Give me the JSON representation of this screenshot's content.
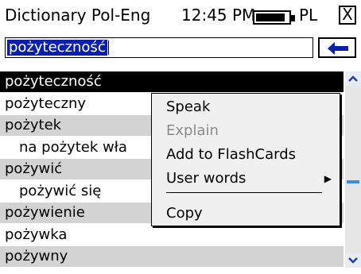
{
  "titlebar": {
    "title": "Dictionary Pol-Eng",
    "time": "12:45 PM",
    "battery_level": 0.9,
    "language": "PL",
    "close_glyph": "X"
  },
  "search": {
    "value": "pożyteczność",
    "back_icon": "back-arrow-icon"
  },
  "list": {
    "items": [
      {
        "label": "pożyteczność",
        "selected": true
      },
      {
        "label": "pożyteczny"
      },
      {
        "label": "pożytek"
      },
      {
        "label": "na pożytek wła"
      },
      {
        "label": "pożywić"
      },
      {
        "label": "pożywić się"
      },
      {
        "label": "pożywienie"
      },
      {
        "label": "pożywka"
      },
      {
        "label": "pożywny"
      }
    ]
  },
  "context_menu": {
    "items": [
      {
        "label": "Speak",
        "enabled": true
      },
      {
        "label": "Explain",
        "enabled": false
      },
      {
        "label": "Add to FlashCards",
        "enabled": true
      },
      {
        "label": "User words",
        "enabled": true,
        "submenu": true
      },
      {
        "label": "Copy",
        "enabled": true
      }
    ]
  },
  "colors": {
    "selection_bg": "#000000",
    "input_selection": "#0a1fb0",
    "row_alt": "#d3d3d3",
    "menu_bg": "#f0f0f0"
  }
}
